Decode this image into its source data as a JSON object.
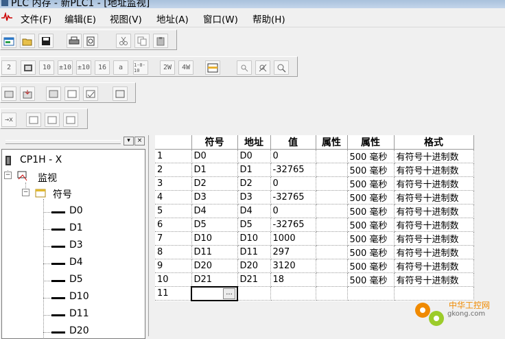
{
  "window": {
    "title": "PLC 内存 - 新PLC1 - [地址监视]"
  },
  "menu": [
    {
      "label": "文件(F)"
    },
    {
      "label": "编辑(E)"
    },
    {
      "label": "视图(V)"
    },
    {
      "label": "地址(A)"
    },
    {
      "label": "窗口(W)"
    },
    {
      "label": "帮助(H)"
    }
  ],
  "toolbar": {
    "row2": [
      "2",
      "",
      "10",
      "±10",
      "±10",
      "16",
      "a",
      "1-0-10",
      "2W",
      "4W",
      "",
      "",
      "",
      ""
    ]
  },
  "tree": {
    "root": "CP1H - X",
    "monitor": "监视",
    "symbols": "符号",
    "leaves": [
      "D0",
      "D1",
      "D3",
      "D4",
      "D5",
      "D10",
      "D11",
      "D20"
    ]
  },
  "grid": {
    "headers": [
      "",
      "符号",
      "地址",
      "值",
      "属性",
      "属性",
      "格式"
    ],
    "rows": [
      {
        "n": "1",
        "sym": "D0",
        "addr": "D0",
        "val": "0",
        "attr": "",
        "period": "500 毫秒",
        "fmt": "有符号十进制数"
      },
      {
        "n": "2",
        "sym": "D1",
        "addr": "D1",
        "val": "-32765",
        "attr": "",
        "period": "500 毫秒",
        "fmt": "有符号十进制数"
      },
      {
        "n": "3",
        "sym": "D2",
        "addr": "D2",
        "val": "0",
        "attr": "",
        "period": "500 毫秒",
        "fmt": "有符号十进制数"
      },
      {
        "n": "4",
        "sym": "D3",
        "addr": "D3",
        "val": "-32765",
        "attr": "",
        "period": "500 毫秒",
        "fmt": "有符号十进制数"
      },
      {
        "n": "5",
        "sym": "D4",
        "addr": "D4",
        "val": "0",
        "attr": "",
        "period": "500 毫秒",
        "fmt": "有符号十进制数"
      },
      {
        "n": "6",
        "sym": "D5",
        "addr": "D5",
        "val": "-32765",
        "attr": "",
        "period": "500 毫秒",
        "fmt": "有符号十进制数"
      },
      {
        "n": "7",
        "sym": "D10",
        "addr": "D10",
        "val": "1000",
        "attr": "",
        "period": "500 毫秒",
        "fmt": "有符号十进制数"
      },
      {
        "n": "8",
        "sym": "D11",
        "addr": "D11",
        "val": "297",
        "attr": "",
        "period": "500 毫秒",
        "fmt": "有符号十进制数"
      },
      {
        "n": "9",
        "sym": "D20",
        "addr": "D20",
        "val": "3120",
        "attr": "",
        "period": "500 毫秒",
        "fmt": "有符号十进制数"
      },
      {
        "n": "10",
        "sym": "D21",
        "addr": "D21",
        "val": "18",
        "attr": "",
        "period": "500 毫秒",
        "fmt": "有符号十进制数"
      }
    ],
    "new_row": {
      "n": "11",
      "ellipsis": "..."
    }
  },
  "watermark": {
    "cn": "中华工控网",
    "en": "gkong.com"
  },
  "colors": {
    "selection_border": "#000000",
    "grid_line": "#9a9a9a",
    "watermark_orange": "#f08a00"
  }
}
